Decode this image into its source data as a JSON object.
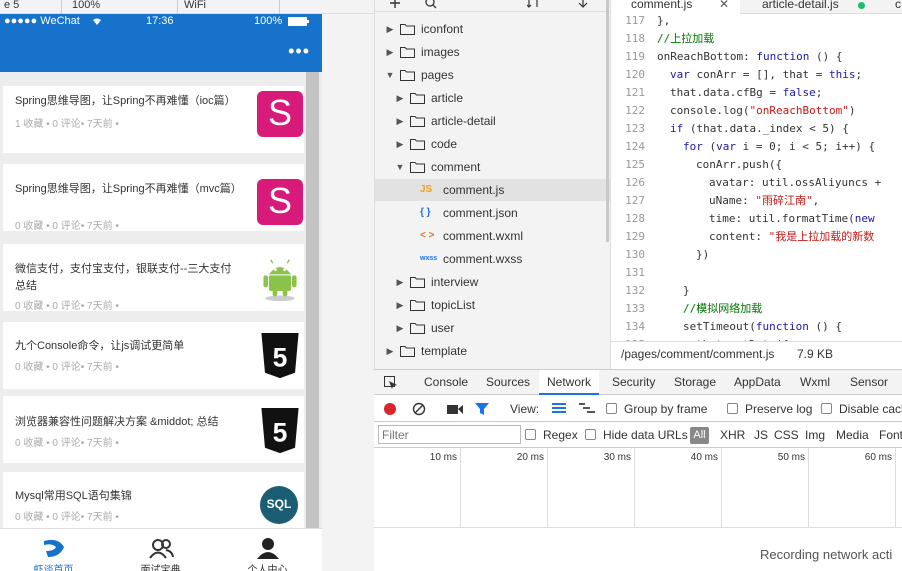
{
  "simulator": {
    "toolbar": {
      "device": "e 5",
      "zoom": "100%",
      "network": "WiFi"
    },
    "status_bar": {
      "signal": "●●●●● WeChat",
      "time": "17:36",
      "battery": "100%"
    },
    "nav": {
      "more": "•••"
    },
    "feed": [
      {
        "title": "Spring思维导图，让Spring不再难懂（ioc篇）",
        "meta": "1 收藏 • 0 评论• 7天前 •",
        "thumb": "S"
      },
      {
        "title": "Spring思维导图，让Spring不再难懂（mvc篇）",
        "meta": "0 收藏 • 0 评论• 7天前 •",
        "thumb": "S"
      },
      {
        "title": "微信支付，支付宝支付，银联支付--三大支付总结",
        "meta": "0 收藏 • 0 评论• 7天前 •",
        "thumb": "android"
      },
      {
        "title": "九个Console命令，让js调试更简单",
        "meta": "0 收藏 • 0 评论• 7天前 •",
        "thumb": "5"
      },
      {
        "title": "浏览器兼容性问题解决方案 &middot; 总结",
        "meta": "0 收藏 • 0 评论• 7天前 •",
        "thumb": "5"
      },
      {
        "title": "Mysql常用SQL语句集锦",
        "meta": "0 收藏 • 0 评论• 7天前 •",
        "thumb": "SQL"
      }
    ],
    "tabbar": [
      {
        "label": "虾谈首页",
        "icon": "shrimp-icon"
      },
      {
        "label": "面试宝典",
        "icon": "people-icon"
      },
      {
        "label": "个人中心",
        "icon": "person-icon"
      }
    ]
  },
  "file_tree": {
    "nodes": [
      {
        "label": "iconfont",
        "kind": "folder",
        "state": "collapsed"
      },
      {
        "label": "images",
        "kind": "folder",
        "state": "collapsed"
      },
      {
        "label": "pages",
        "kind": "folder",
        "state": "expanded"
      },
      {
        "label": "article",
        "kind": "folder",
        "state": "collapsed"
      },
      {
        "label": "article-detail",
        "kind": "folder",
        "state": "collapsed"
      },
      {
        "label": "code",
        "kind": "folder",
        "state": "collapsed"
      },
      {
        "label": "comment",
        "kind": "folder",
        "state": "expanded"
      },
      {
        "label": "comment.js",
        "kind": "file",
        "badge": "JS"
      },
      {
        "label": "comment.json",
        "kind": "file",
        "badge": "{ }"
      },
      {
        "label": "comment.wxml",
        "kind": "file",
        "badge": "< >"
      },
      {
        "label": "comment.wxss",
        "kind": "file",
        "badge": "wxss"
      },
      {
        "label": "interview",
        "kind": "folder",
        "state": "collapsed"
      },
      {
        "label": "topicList",
        "kind": "folder",
        "state": "collapsed"
      },
      {
        "label": "user",
        "kind": "folder",
        "state": "collapsed"
      },
      {
        "label": "template",
        "kind": "folder",
        "state": "collapsed"
      }
    ]
  },
  "editor": {
    "tabs": [
      {
        "label": "comment.js",
        "active": true
      },
      {
        "label": "article-detail.js",
        "active": false
      },
      {
        "label": "c",
        "active": false
      }
    ],
    "lines": [
      {
        "n": "117",
        "t": "},",
        "ind": 1
      },
      {
        "n": "118",
        "t": "//上拉加载",
        "ind": 1,
        "cls": "cmt"
      },
      {
        "n": "119",
        "t": "onReachBottom: function () {",
        "ind": 1
      },
      {
        "n": "120",
        "t": "var conArr = [], that = this;",
        "ind": 2
      },
      {
        "n": "121",
        "t": "that.data.cfBg = false;",
        "ind": 2
      },
      {
        "n": "122",
        "t": "console.log(\"onReachBottom\")",
        "ind": 2
      },
      {
        "n": "123",
        "t": "if (that.data._index < 5) {",
        "ind": 2
      },
      {
        "n": "124",
        "t": "for (var i = 0; i < 5; i++) {",
        "ind": 3
      },
      {
        "n": "125",
        "t": "conArr.push({",
        "ind": 4
      },
      {
        "n": "126",
        "t": "avatar: util.ossAliyuncs +",
        "ind": 5
      },
      {
        "n": "127",
        "t": "uName: \"雨碎江南\",",
        "ind": 5
      },
      {
        "n": "128",
        "t": "time: util.formatTime(new",
        "ind": 5
      },
      {
        "n": "129",
        "t": "content: \"我是上拉加载的新数",
        "ind": 5
      },
      {
        "n": "130",
        "t": "})",
        "ind": 4
      },
      {
        "n": "131",
        "t": "",
        "ind": 0
      },
      {
        "n": "132",
        "t": "}",
        "ind": 3
      },
      {
        "n": "133",
        "t": "//模拟网络加载",
        "ind": 3,
        "cls": "cmt"
      },
      {
        "n": "134",
        "t": "setTimeout(function () {",
        "ind": 3
      },
      {
        "n": "135",
        "t": "that.setData({",
        "ind": 4
      }
    ],
    "status": {
      "path": "/pages/comment/comment.js",
      "size": "7.9 KB"
    }
  },
  "devtools": {
    "tabs": [
      "Console",
      "Sources",
      "Network",
      "Security",
      "Storage",
      "AppData",
      "Wxml",
      "Sensor"
    ],
    "active_tab": "Network",
    "toolbar": {
      "view_label": "View:",
      "group_by_frame": "Group by frame",
      "preserve_log": "Preserve log",
      "disable_cache": "Disable cach"
    },
    "filter": {
      "placeholder": "Filter",
      "regex": "Regex",
      "hide_data_urls": "Hide data URLs",
      "types": [
        "All",
        "XHR",
        "JS",
        "CSS",
        "Img",
        "Media",
        "Font"
      ]
    },
    "ticks": [
      "10 ms",
      "20 ms",
      "30 ms",
      "40 ms",
      "50 ms",
      "60 ms"
    ],
    "empty_message": "Recording network acti"
  },
  "colors": {
    "brand_blue": "#1772cc",
    "thumb_pink": "#d81b7a",
    "android_green": "#8bc34a",
    "sql_teal": "#1b5e73",
    "record_red": "#d9262a",
    "filter_blue": "#1a73e8"
  }
}
